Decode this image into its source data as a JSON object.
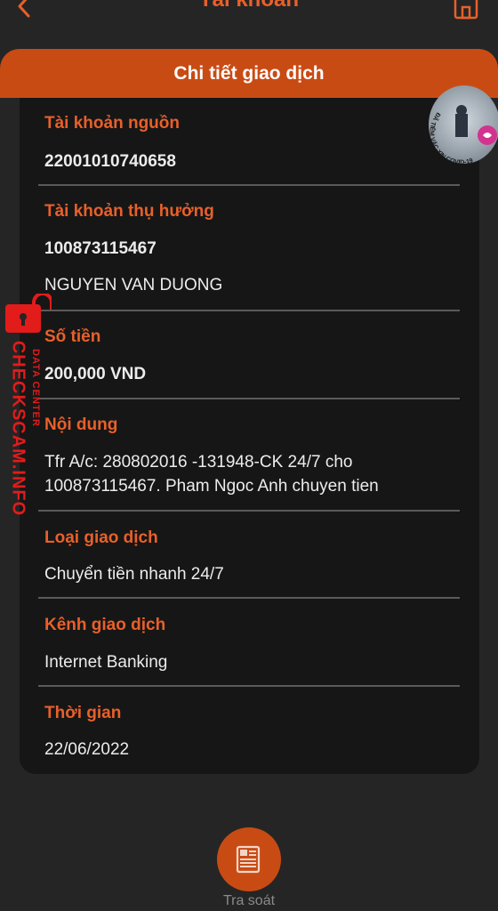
{
  "header": {
    "title": "Tài khoản"
  },
  "panel": {
    "title": "Chi tiết giao dịch"
  },
  "fields": {
    "source_account": {
      "label": "Tài khoản nguồn",
      "value": "22001010740658"
    },
    "beneficiary": {
      "label": "Tài khoản thụ hưởng",
      "account": "100873115467",
      "name": "NGUYEN VAN DUONG"
    },
    "amount": {
      "label": "Số tiền",
      "value": "200,000 VND"
    },
    "content": {
      "label": "Nội dung",
      "line1": "Tfr A/c: 280802016 -131948-CK 24/7 cho",
      "line2": "100873115467. Pham Ngoc Anh chuyen tien"
    },
    "transaction_type": {
      "label": "Loại giao dịch",
      "value": "Chuyển tiền nhanh 24/7"
    },
    "channel": {
      "label": "Kênh giao dịch",
      "value": "Internet Banking"
    },
    "time": {
      "label": "Thời gian",
      "value": "22/06/2022"
    }
  },
  "actions": {
    "trace_label": "Tra soát"
  },
  "overlays": {
    "watermark_main": "CHECKSCAM.INFO",
    "watermark_sub": "DATA CENTER",
    "avatar_text": "ĐÃ TIÊM VẮC-XIN COVID-19"
  },
  "colors": {
    "accent": "#e8602a",
    "header_band": "#c94b14",
    "background": "#252525",
    "card": "#161616",
    "watermark": "#e21b1b"
  }
}
